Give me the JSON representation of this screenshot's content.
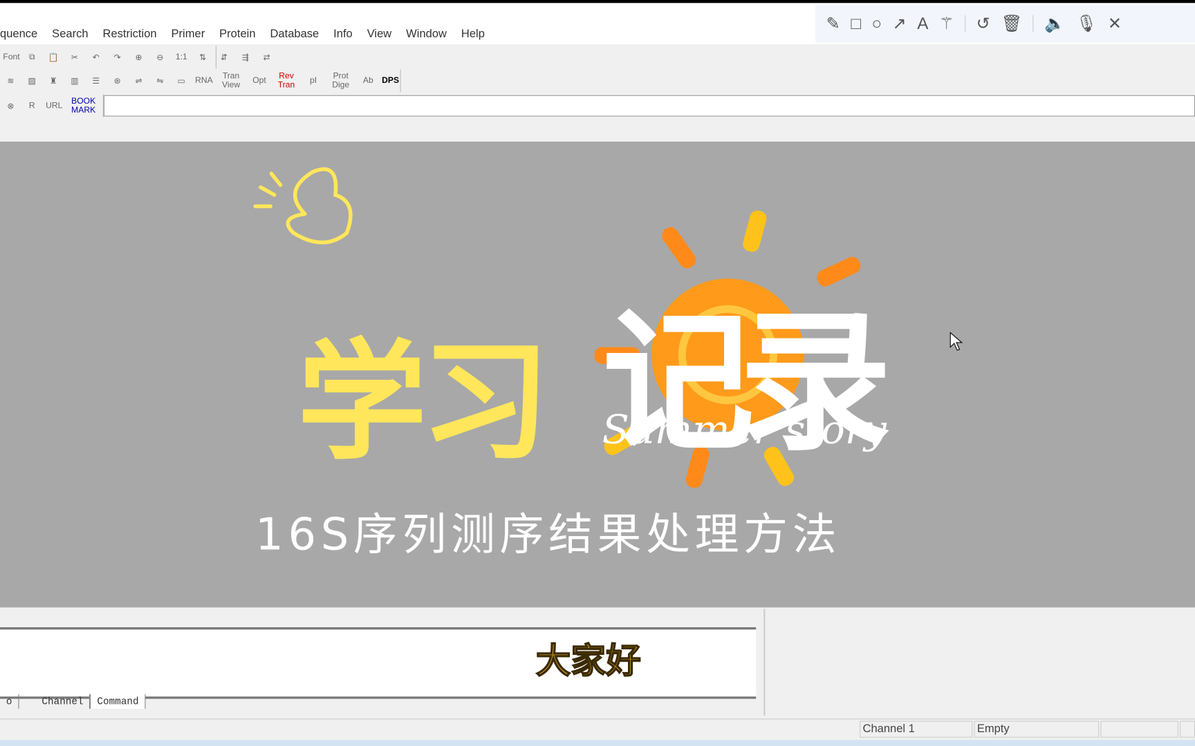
{
  "menu": [
    "quence",
    "Search",
    "Restriction",
    "Primer",
    "Protein",
    "Database",
    "Info",
    "View",
    "Window",
    "Help"
  ],
  "annotation_toolbar": [
    "pencil-icon",
    "rectangle-icon",
    "circle-icon",
    "arrow-icon",
    "text-icon",
    "magic-wand-icon",
    "undo-icon",
    "trash-icon",
    "speaker-icon",
    "microphone-icon",
    "close-icon"
  ],
  "toolbar1": [
    "Font",
    "⧉",
    "📋",
    "✂",
    "↶",
    "↷",
    "⊕",
    "⊖",
    "1:1",
    "⇅",
    "⇵",
    "⇶",
    "⇄"
  ],
  "toolbar2": [
    "≋",
    "▨",
    "♜",
    "▥",
    "☰",
    "⊛",
    "⇌",
    "⇋",
    "▭",
    "RNA",
    "Tran View",
    "Opt",
    "Rev Tran",
    "pI",
    "Prot Dige",
    "Ab",
    "DPS"
  ],
  "toolbar3": [
    "⊗",
    "R",
    "URL",
    "BOOK MARK"
  ],
  "address_value": "",
  "overlay": {
    "title_yellow": "学习",
    "title_white": "记录",
    "script": "Summer story",
    "subtitle": "16S序列测序结果处理方法"
  },
  "bottom": {
    "greeting": "大家好",
    "tabs": [
      "o",
      "Channel",
      "Command"
    ]
  },
  "status": [
    "Channel 1",
    "Empty",
    "",
    ""
  ],
  "colors": {
    "yellow": "#ffe65a",
    "sun": "#ff9a1a",
    "background": "#a8a8a8"
  }
}
